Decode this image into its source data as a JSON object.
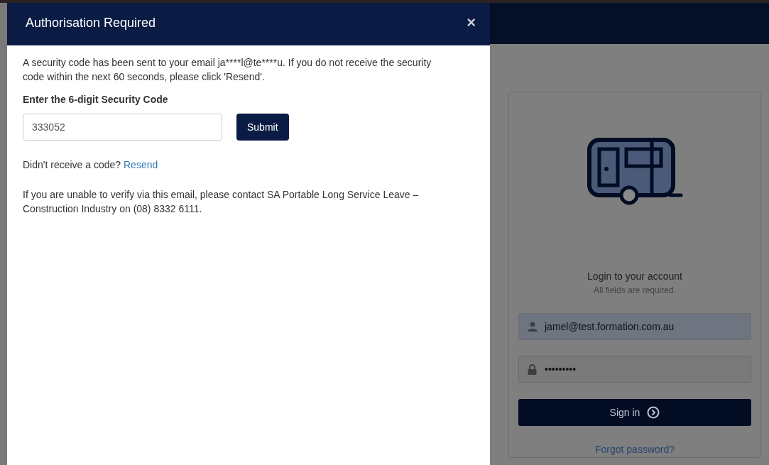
{
  "modal": {
    "title": "Authorisation Required",
    "close": "×",
    "message": "A security code has been sent to your email ja****l@te****u. If you do not receive the security code within the next 60 seconds, please click 'Resend'.",
    "code_label": "Enter the 6-digit Security Code",
    "code_field": {
      "value": "333052"
    },
    "submit": "Submit",
    "resend_prompt": "Didn't receive a code?",
    "resend_link": "Resend",
    "contact_note": "If you are unable to verify via this email, please contact SA Portable Long Service Leave – Construction Industry on (08) 8332 6111."
  },
  "login": {
    "title": "Login to your account",
    "subtitle": "All fields are required.",
    "email": {
      "value": "jamel@test.formation.com.au"
    },
    "password": {
      "value": "•••••••••"
    },
    "sign_in": "Sign in",
    "forgot": "Forgot password?"
  }
}
